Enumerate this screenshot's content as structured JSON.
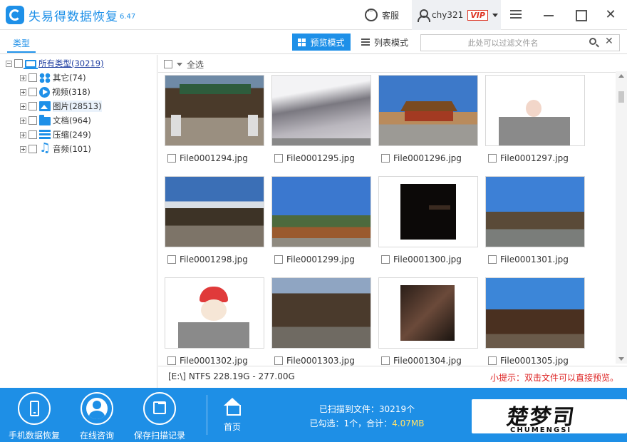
{
  "app": {
    "title": "失易得数据恢复",
    "version": "6.47"
  },
  "titlebar": {
    "service_label": "客服",
    "username": "chy321",
    "vip_label": "VIP"
  },
  "toolbar": {
    "type_tab": "类型",
    "preview_mode": "预览模式",
    "list_mode": "列表模式",
    "search_placeholder": "此处可以过滤文件名"
  },
  "tree": {
    "root": "所有类型(30219)",
    "items": [
      {
        "label": "其它(74)",
        "icon": "other-icon"
      },
      {
        "label": "视频(318)",
        "icon": "video-icon"
      },
      {
        "label": "图片(28513)",
        "icon": "image-icon"
      },
      {
        "label": "文档(964)",
        "icon": "document-icon"
      },
      {
        "label": "压缩(249)",
        "icon": "archive-icon"
      },
      {
        "label": "音频(101)",
        "icon": "audio-icon"
      }
    ]
  },
  "content": {
    "select_all": "全选",
    "files": [
      {
        "name": "File0001294.jpg"
      },
      {
        "name": "File0001295.jpg"
      },
      {
        "name": "File0001296.jpg"
      },
      {
        "name": "File0001297.jpg"
      },
      {
        "name": "File0001298.jpg"
      },
      {
        "name": "File0001299.jpg"
      },
      {
        "name": "File0001300.jpg"
      },
      {
        "name": "File0001301.jpg"
      },
      {
        "name": "File0001302.jpg"
      },
      {
        "name": "File0001303.jpg"
      },
      {
        "name": "File0001304.jpg"
      },
      {
        "name": "File0001305.jpg"
      }
    ]
  },
  "status": {
    "disk_info": "[E:\\] NTFS 228.19G - 277.00G",
    "tip": "小提示：双击文件可以直接预览。"
  },
  "bottom": {
    "phone_recovery": "手机数据恢复",
    "online_consult": "在线咨询",
    "save_scan": "保存扫描记录",
    "home": "首页",
    "scanned_label": "已扫描到文件：30219个",
    "checked_label": "已勾选：1个，合计：",
    "checked_size": "4.07MB"
  },
  "watermark": {
    "big": "楚梦司",
    "small": "CHUMENGSI"
  },
  "colors": {
    "accent": "#1e90e8",
    "bottom_bar": "#1e8fe6",
    "tip": "#dd2222",
    "highlight": "#ffe26a"
  }
}
